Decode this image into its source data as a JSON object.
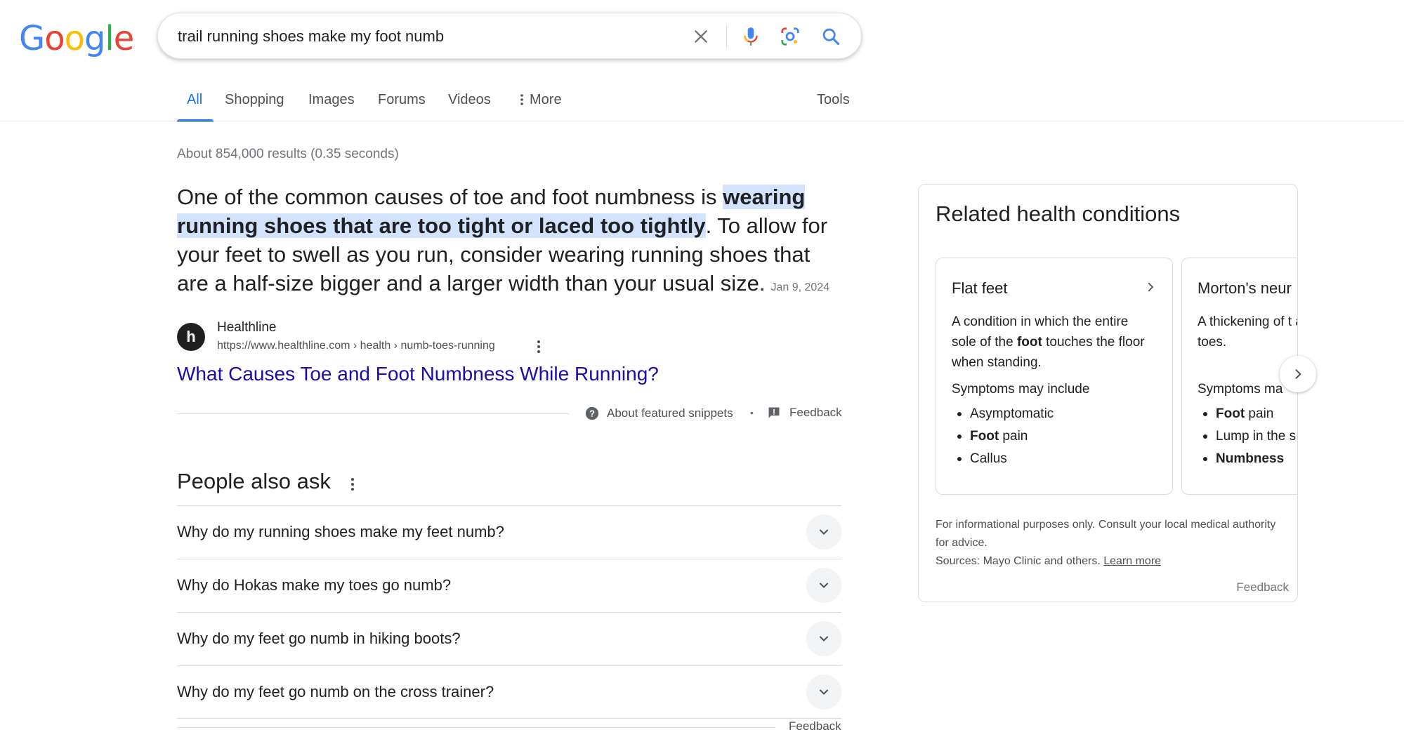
{
  "header": {
    "logo": [
      "G",
      "o",
      "o",
      "g",
      "l",
      "e"
    ],
    "query": "trail running shoes make my foot numb"
  },
  "tabs": [
    {
      "label": "All"
    },
    {
      "label": "Shopping"
    },
    {
      "label": "Images"
    },
    {
      "label": "Forums"
    },
    {
      "label": "Videos"
    },
    {
      "label": "More"
    }
  ],
  "tools_label": "Tools",
  "stats": "About 854,000 results (0.35 seconds)",
  "snippet": {
    "before": "One of the common causes of toe and foot numbness is ",
    "highlight": "wearing running shoes that are too tight or laced too tightly",
    "after": ". To allow for your feet to swell as you run, consider wearing running shoes that are a half-size bigger and a larger width than your usual size.",
    "date": "Jan 9, 2024"
  },
  "source": {
    "name": "Healthline",
    "url": "https://www.healthline.com › health › numb-toes-running",
    "title": "What Causes Toe and Foot Numbness While Running?"
  },
  "snippet_footer": {
    "about": "About featured snippets",
    "feedback": "Feedback"
  },
  "paa": {
    "title": "People also ask",
    "questions": [
      "Why do my running shoes make my feet numb?",
      "Why do Hokas make my toes go numb?",
      "Why do my feet go numb in hiking boots?",
      "Why do my feet go numb on the cross trainer?"
    ],
    "feedback": "Feedback"
  },
  "knowledge_panel": {
    "title": "Related health conditions",
    "cards": [
      {
        "name": "Flat feet",
        "desc_before": "A condition in which the entire sole of the ",
        "desc_bold": "foot",
        "desc_after": " touches the floor when standing.",
        "symptoms_label": "Symptoms may include",
        "symptoms": [
          {
            "text": "Asymptomatic"
          },
          {
            "bold": "Foot",
            "text": " pain"
          },
          {
            "text": "Callus"
          }
        ]
      },
      {
        "name": "Morton's neur",
        "desc_before": "A thickening of t",
        "desc_bold": "",
        "desc_after": " around a nerve l toes.",
        "symptoms_label": "Symptoms ma",
        "symptoms": [
          {
            "bold": "Foot",
            "text": " pain"
          },
          {
            "text": "Lump in the s"
          },
          {
            "bold": "Numbness",
            "text": ""
          }
        ]
      }
    ],
    "disclaimer": "For informational purposes only. Consult your local medical authority for advice.",
    "sources_prefix": "Sources: Mayo Clinic and others. ",
    "learn_more": "Learn more",
    "feedback": "Feedback"
  },
  "colors": {
    "link": "#1a0dab",
    "accent": "#1a73e8",
    "highlight": "#d3e3fd"
  },
  "icons": [
    "clear-icon",
    "microphone-icon",
    "lens-icon",
    "search-icon",
    "more-vert-icon",
    "help-circle-icon",
    "feedback-icon",
    "chevron-down-icon",
    "chevron-right-icon"
  ]
}
